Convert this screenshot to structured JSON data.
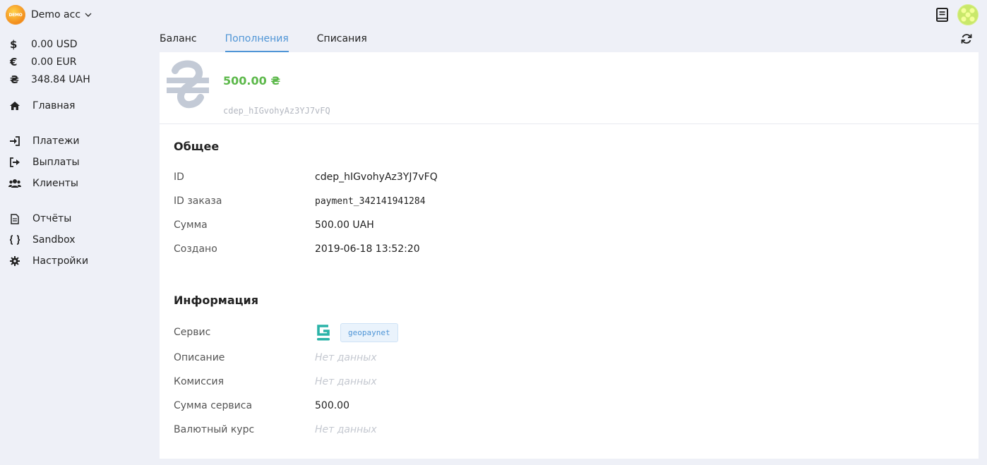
{
  "account": {
    "logo_text": "DEMO",
    "name": "Demo acc"
  },
  "balances": [
    {
      "symbol": "$",
      "value": "0.00 USD"
    },
    {
      "symbol": "€",
      "value": "0.00 EUR"
    },
    {
      "symbol": "₴",
      "value": "348.84 UAH"
    }
  ],
  "nav": {
    "home": "Главная",
    "payments": "Платежи",
    "payouts": "Выплаты",
    "clients": "Клиенты",
    "reports": "Отчёты",
    "sandbox": "Sandbox",
    "settings": "Настройки"
  },
  "tabs": [
    "Баланс",
    "Пополнения",
    "Списания"
  ],
  "active_tab": "Пополнения",
  "deposit": {
    "currency_symbol": "₴",
    "amount": "500.00 ₴",
    "id": "cdep_hIGvohyAz3YJ7vFQ"
  },
  "general": {
    "title": "Общее",
    "rows": [
      {
        "label": "ID",
        "value": "cdep_hIGvohyAz3YJ7vFQ"
      },
      {
        "label": "ID заказа",
        "value": "payment_342141941284"
      },
      {
        "label": "Сумма",
        "value": "500.00 UAH"
      },
      {
        "label": "Создано",
        "value": "2019-06-18 13:52:20"
      }
    ]
  },
  "info": {
    "title": "Информация",
    "service_label": "Сервис",
    "service_tag": "geopaynet",
    "description_label": "Описание",
    "commission_label": "Комиссия",
    "service_amount_label": "Сумма сервиса",
    "service_amount_value": "500.00",
    "rate_label": "Валютный курс",
    "no_data": "Нет данных"
  },
  "colors": {
    "accent": "#4f95d6",
    "amount_green": "#5cb84a",
    "service_brand": "#2bb3a8"
  }
}
